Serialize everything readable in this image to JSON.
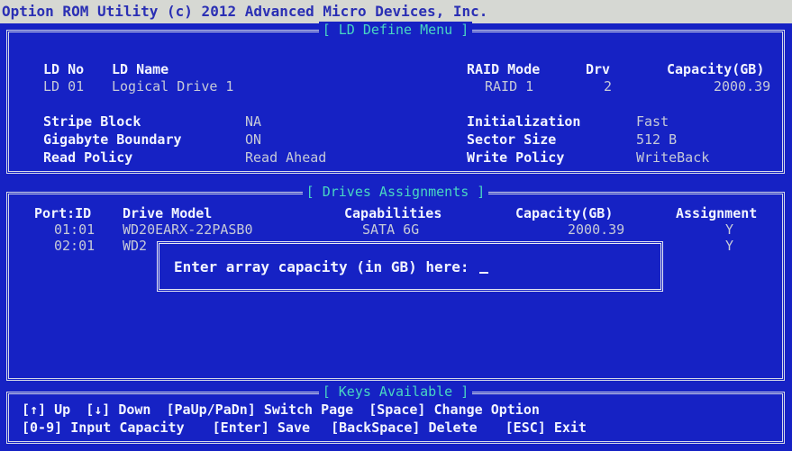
{
  "app_title": "Option ROM Utility (c) 2012 Advanced Micro Devices, Inc.",
  "ld_define": {
    "title": "[ LD Define Menu ]",
    "headers": {
      "ld_no": "LD No",
      "ld_name": "LD Name",
      "raid_mode": "RAID Mode",
      "drv": "Drv",
      "capacity": "Capacity(GB)"
    },
    "row": {
      "ld_no": "LD 01",
      "ld_name": "Logical Drive 1",
      "raid_mode": "RAID 1",
      "drv": "2",
      "capacity": "2000.39"
    },
    "settings_left": [
      {
        "label": "Stripe Block",
        "value": "NA"
      },
      {
        "label": "Gigabyte Boundary",
        "value": "ON"
      },
      {
        "label": "Read Policy",
        "value": "Read Ahead"
      }
    ],
    "settings_right": [
      {
        "label": "Initialization",
        "value": "Fast"
      },
      {
        "label": "Sector Size",
        "value": "512  B"
      },
      {
        "label": "Write Policy",
        "value": "WriteBack"
      }
    ]
  },
  "drives": {
    "title": "[ Drives Assignments ]",
    "headers": {
      "port": "Port:ID",
      "model": "Drive Model",
      "capabilities": "Capabilities",
      "capacity": "Capacity(GB)",
      "assignment": "Assignment"
    },
    "rows": [
      {
        "port": "01:01",
        "model": "WD20EARX-22PASB0",
        "capabilities": "SATA 6G",
        "capacity": "2000.39",
        "assignment": "Y"
      },
      {
        "port": "02:01",
        "model": "WD2",
        "capabilities": "",
        "capacity": "",
        "assignment": "Y"
      }
    ]
  },
  "dialog": {
    "prompt": "Enter array capacity (in GB) here:"
  },
  "keys": {
    "title": "[ Keys Available ]",
    "line1": [
      {
        "key": "[↑]",
        "action": "Up"
      },
      {
        "key": "[↓]",
        "action": "Down"
      },
      {
        "key": "[PaUp/PaDn]",
        "action": "Switch Page"
      },
      {
        "key": "[Space]",
        "action": "Change Option"
      }
    ],
    "line2": [
      {
        "key": "[0-9]",
        "action": "Input Capacity"
      },
      {
        "key": "[Enter]",
        "action": "Save"
      },
      {
        "key": "[BackSpace]",
        "action": "Delete"
      },
      {
        "key": "[ESC]",
        "action": "Exit"
      }
    ]
  },
  "colors": {
    "background": "#1622c4",
    "title_bar": "#d6d8d3",
    "panel_title": "#49d6c2",
    "text_bright": "#f2f4ff"
  }
}
